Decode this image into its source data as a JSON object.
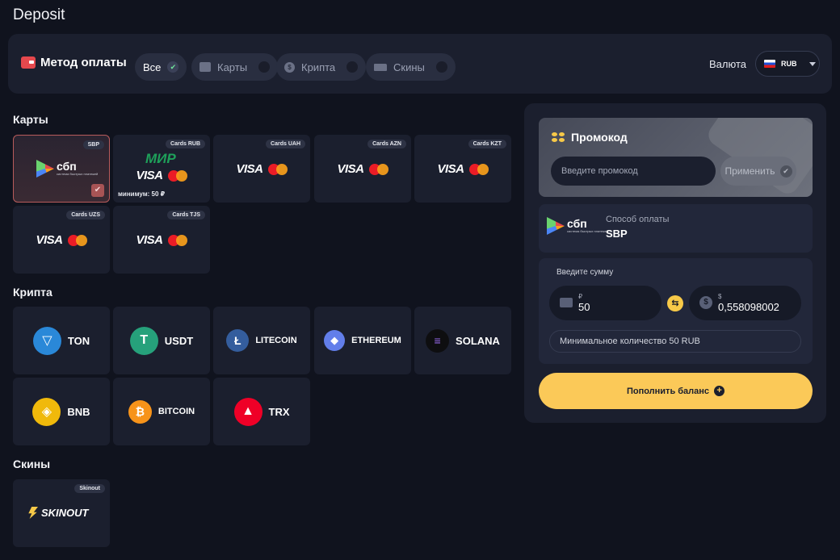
{
  "page": {
    "title": "Deposit"
  },
  "filter": {
    "label": "Метод оплаты",
    "chips": [
      {
        "label": "Все",
        "active": true
      },
      {
        "label": "Карты",
        "active": false
      },
      {
        "label": "Крипта",
        "active": false
      },
      {
        "label": "Скины",
        "active": false
      }
    ],
    "currency_label": "Валюта",
    "currency_value": "RUB"
  },
  "sections": {
    "cards_title": "Карты",
    "crypto_title": "Крипта",
    "skins_title": "Скины"
  },
  "cards": [
    {
      "badge": "SBP",
      "brand": "сбп",
      "brand_sub": "система быстрых платежей",
      "selected": true
    },
    {
      "badge": "Cards RUB",
      "mir": "МИР",
      "minimum": "минимум: 50 ₽"
    },
    {
      "badge": "Cards UAH"
    },
    {
      "badge": "Cards AZN"
    },
    {
      "badge": "Cards KZT"
    },
    {
      "badge": "Cards UZS"
    },
    {
      "badge": "Cards TJS"
    }
  ],
  "visa_text": "VISA",
  "crypto": [
    {
      "name": "TON",
      "color": "#2a88d8",
      "glyph": "▽"
    },
    {
      "name": "USDT",
      "color": "#26a17b",
      "glyph": "T"
    },
    {
      "name": "LITECOIN",
      "color": "#345d9d",
      "glyph": "Ł"
    },
    {
      "name": "ETHEREUM",
      "color": "#627eea",
      "glyph": "◆"
    },
    {
      "name": "SOLANA",
      "color": "#0e0e10",
      "glyph": "≡"
    },
    {
      "name": "BNB",
      "color": "#f0b90b",
      "glyph": "◈"
    },
    {
      "name": "BITCOIN",
      "color": "#f7931a",
      "glyph": "₿"
    },
    {
      "name": "TRX",
      "color": "#ef0027",
      "glyph": "▲"
    }
  ],
  "skins": [
    {
      "badge": "Skinout",
      "name": "SKINOUT"
    }
  ],
  "promo": {
    "title": "Промокод",
    "placeholder": "Введите промокод",
    "apply": "Применить"
  },
  "method": {
    "sub": "Способ оплаты",
    "name": "SBP"
  },
  "amount": {
    "label": "Введите сумму",
    "rub_symbol": "₽",
    "rub_value": "50",
    "usd_symbol": "$",
    "usd_value": "0,558098002",
    "min_note": "Минимальное количество 50 RUB"
  },
  "submit": {
    "label": "Пополнить баланс"
  }
}
